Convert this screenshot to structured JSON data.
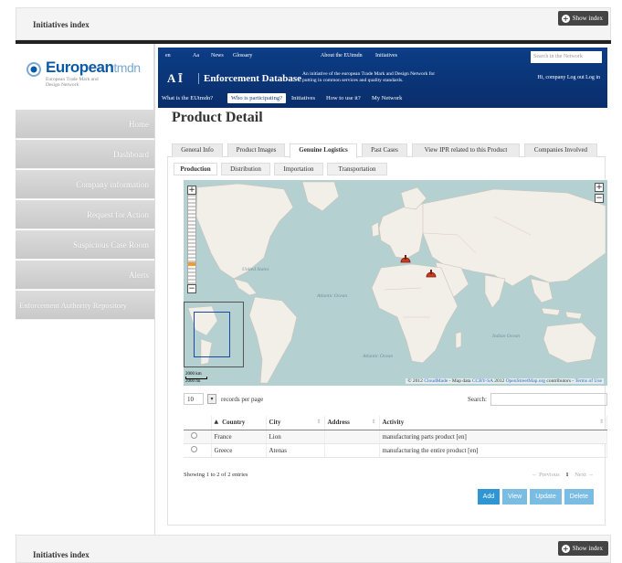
{
  "top_bar": {
    "title": "Initiatives index",
    "show_label": "Show index"
  },
  "bottom_bar": {
    "title": "Initiatives index",
    "show_label": "Show index"
  },
  "logo": {
    "brand_bold": "European",
    "brand_light": "tmdn",
    "subtitle": "European Trade Mark and Design Network"
  },
  "sidebar": {
    "items": [
      {
        "label": "Home"
      },
      {
        "label": "Dashboard"
      },
      {
        "label": "Company information"
      },
      {
        "label": "Request for Action"
      },
      {
        "label": "Suspicious Case Room"
      },
      {
        "label": "Alerts"
      },
      {
        "label": "Enforcement Authority Repository"
      }
    ]
  },
  "eu_header": {
    "top_links": [
      "en",
      "Aa",
      "News",
      "Glossary",
      "About the EUtmdn",
      "Initiatives"
    ],
    "search_placeholder": "Search in the Network",
    "title": "Enforcement Database",
    "description": "An initiative of the european Trade Mark and Design Network for putting in common services and quality standards.",
    "user_text": "Hi, company  Log out  Log in",
    "nav": [
      "What is the EUtmdn?",
      "Who is participating?",
      "Initiatives",
      "How to use it?",
      "My Network"
    ],
    "nav_active_index": 1
  },
  "page": {
    "title": "Product Detail"
  },
  "tabs": [
    "General Info",
    "Product Images",
    "Genuine Logistics",
    "Past Cases",
    "View IPR related to this Product",
    "Companies Involved"
  ],
  "active_tab": "Genuine Logistics",
  "subtabs": [
    "Production",
    "Distribution",
    "Importation",
    "Transportation"
  ],
  "active_subtab": "Production",
  "map": {
    "zoom_in": "+",
    "zoom_out": "−",
    "scale_top": "2000 km",
    "scale_bottom": "2000 mi",
    "attribution_prefix": "© 2012",
    "attribution_provider": "CloudMade",
    "attribution_mid": " - Map data",
    "attribution_license": "CCBY-SA",
    "attribution_year": " 2012 ",
    "attribution_osm": "OpenStreetMap.org",
    "attribution_contrib": " contributors - ",
    "attribution_terms": "Terms of Use",
    "labels": {
      "atlantic_1": "Atlantic Ocean",
      "atlantic_2": "Atlantic Ocean",
      "indian": "Indian Ocean",
      "united_states": "United States"
    },
    "marker_color": "#cc3b1e"
  },
  "table": {
    "page_length": "10",
    "length_label": "records per page",
    "search_label": "Search:",
    "columns": [
      "",
      "Country",
      "City",
      "Address",
      "Activity"
    ],
    "rows": [
      {
        "country": "France",
        "city": "Lion",
        "address": "",
        "activity": "manufacturing parts product [en]"
      },
      {
        "country": "Greece",
        "city": "Atenas",
        "address": "",
        "activity": "manufacturing the entire product [en]"
      }
    ],
    "info": "Showing 1 to 2 of 2 entries",
    "pager_prev": "← Previous",
    "pager_current": "1",
    "pager_next": "Next →"
  },
  "actions": {
    "add": "Add",
    "view": "View",
    "update": "Update",
    "delete": "Delete"
  },
  "colors": {
    "accent": "#2f95d3",
    "header": "#0c3d86",
    "marker": "#cc3b1e",
    "brand": "#0a5aa8"
  }
}
